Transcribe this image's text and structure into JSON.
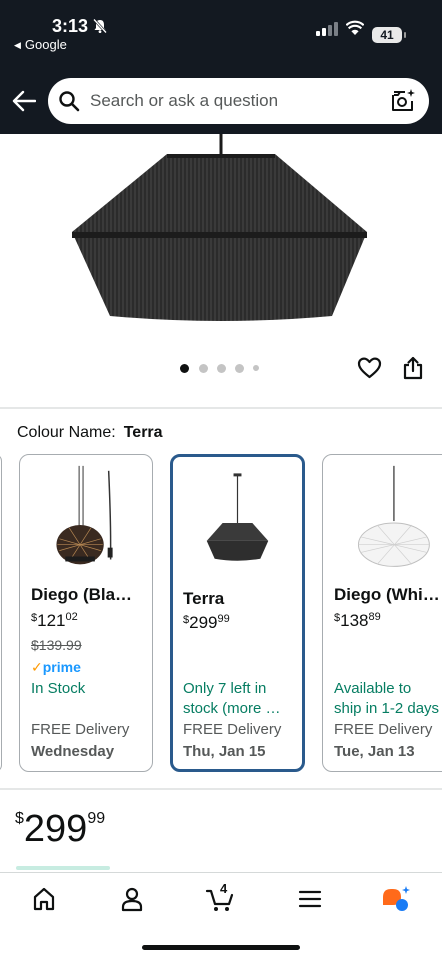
{
  "status": {
    "time": "3:13",
    "back_app": "Google",
    "battery": "41"
  },
  "search": {
    "placeholder": "Search or ask a question"
  },
  "gallery": {
    "image_count": 5,
    "active_index": 0
  },
  "colour": {
    "label": "Colour Name:",
    "value": "Terra"
  },
  "variants": [
    {
      "name": "Diego (Bla…",
      "price_currency": "$",
      "price_whole": "121",
      "price_cents": "02",
      "was_price": "$139.99",
      "prime": "prime",
      "stock": "In Stock",
      "delivery": "FREE Delivery",
      "delivery_date": "Wednesday"
    },
    {
      "name": "Terra",
      "price_currency": "$",
      "price_whole": "299",
      "price_cents": "99",
      "stock_line1": "Only 7 left in",
      "stock_line2": "stock (more …",
      "delivery": "FREE Delivery",
      "delivery_date": "Thu, Jan 15",
      "selected": true
    },
    {
      "name": "Diego (Whi…",
      "price_currency": "$",
      "price_whole": "138",
      "price_cents": "89",
      "stock_line1": "Available to",
      "stock_line2": "ship in 1-2 days",
      "delivery": "FREE Delivery",
      "delivery_date": "Tue, Jan 13"
    }
  ],
  "price": {
    "currency": "$",
    "whole": "299",
    "cents": "99"
  },
  "nav": {
    "cart_count": "4",
    "items": [
      "home-icon",
      "account-icon",
      "cart-icon",
      "menu-icon",
      "rufus-icon"
    ]
  },
  "colors": {
    "header_bg": "#131921",
    "selected_border": "#2a5a8c",
    "stock_green": "#067d62",
    "prime_blue": "#1a98ff",
    "prime_orange": "#ff9900",
    "rufus_orange": "#ff6a1a",
    "rufus_blue": "#1a7cf5"
  }
}
